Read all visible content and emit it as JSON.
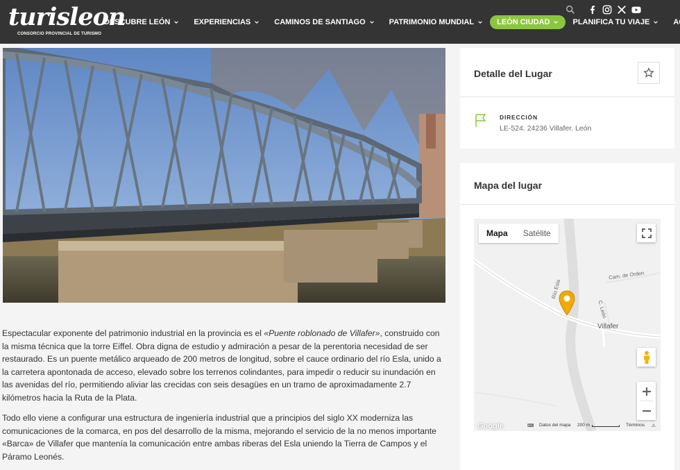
{
  "brand": {
    "name": "turisleon",
    "tagline": "CONSORCIO PROVINCIAL DE TURISMO"
  },
  "nav": {
    "items": [
      {
        "label": "DESCUBRE LEÓN",
        "has_dropdown": true
      },
      {
        "label": "EXPERIENCIAS",
        "has_dropdown": true
      },
      {
        "label": "CAMINOS DE SANTIAGO",
        "has_dropdown": true
      },
      {
        "label": "PATRIMONIO MUNDIAL",
        "has_dropdown": true
      },
      {
        "label": "LEÓN CIUDAD",
        "has_dropdown": true,
        "active": true
      },
      {
        "label": "PLANIFICA TU VIAJE",
        "has_dropdown": true
      },
      {
        "label": "AGENDA",
        "has_dropdown": false
      }
    ],
    "active_color": "#8cc63f"
  },
  "header_icons": [
    "search-icon",
    "facebook-icon",
    "instagram-icon",
    "x-icon",
    "youtube-icon"
  ],
  "article": {
    "p1_before": "Espectacular exponente del patrimonio industrial en la provincia es el ",
    "p1_em": "«Puente roblonado de Villafer»",
    "p1_after": ", construido con la misma técnica que la torre Eiffel. Obra digna de estudio y admiración a pesar de la perentoria necesidad de ser restaurado. Es un puente metálico arqueado de 200 metros de longitud, sobre el cauce ordinario del río Esla, unido a la carretera apontonada de acceso, elevado sobre los terrenos colindantes, para impedir o reducir su inundación en las avenidas del río, permitiendo aliviar las crecidas con seis desagües en un tramo de aproximadamente 2.7 kilómetros hacia la Ruta de la Plata.",
    "p2": "Todo ello viene a configurar una estructura de ingeniería industrial que a principios del siglo XX moderniza las comunicaciones de la comarca, en pos del desarrollo de la misma, mejorando el servicio de la no menos importante «Barca» de Villafer que mantenía la comunicación entre ambas riberas del Esla uniendo la Tierra de Campos y el Páramo Leonés."
  },
  "sidebar": {
    "detail": {
      "title": "Detalle del Lugar",
      "address_label": "DIRECCIÓN",
      "address_value": "LE-524. 24236 Villafer. León"
    },
    "map_card": {
      "title": "Mapa del lugar",
      "map_type_options": [
        "Mapa",
        "Satélite"
      ],
      "map_type_selected": "Mapa",
      "labels": {
        "road_1": "Cam. de Orden",
        "river": "Río Esla",
        "road_2": "C. León",
        "town": "Villafer"
      },
      "footer": {
        "google": "Google",
        "keyboard": "⌨",
        "data": "Datos del mapa",
        "scale": "200 m",
        "terms": "Términos"
      },
      "pin_color": "#f2a900"
    }
  }
}
